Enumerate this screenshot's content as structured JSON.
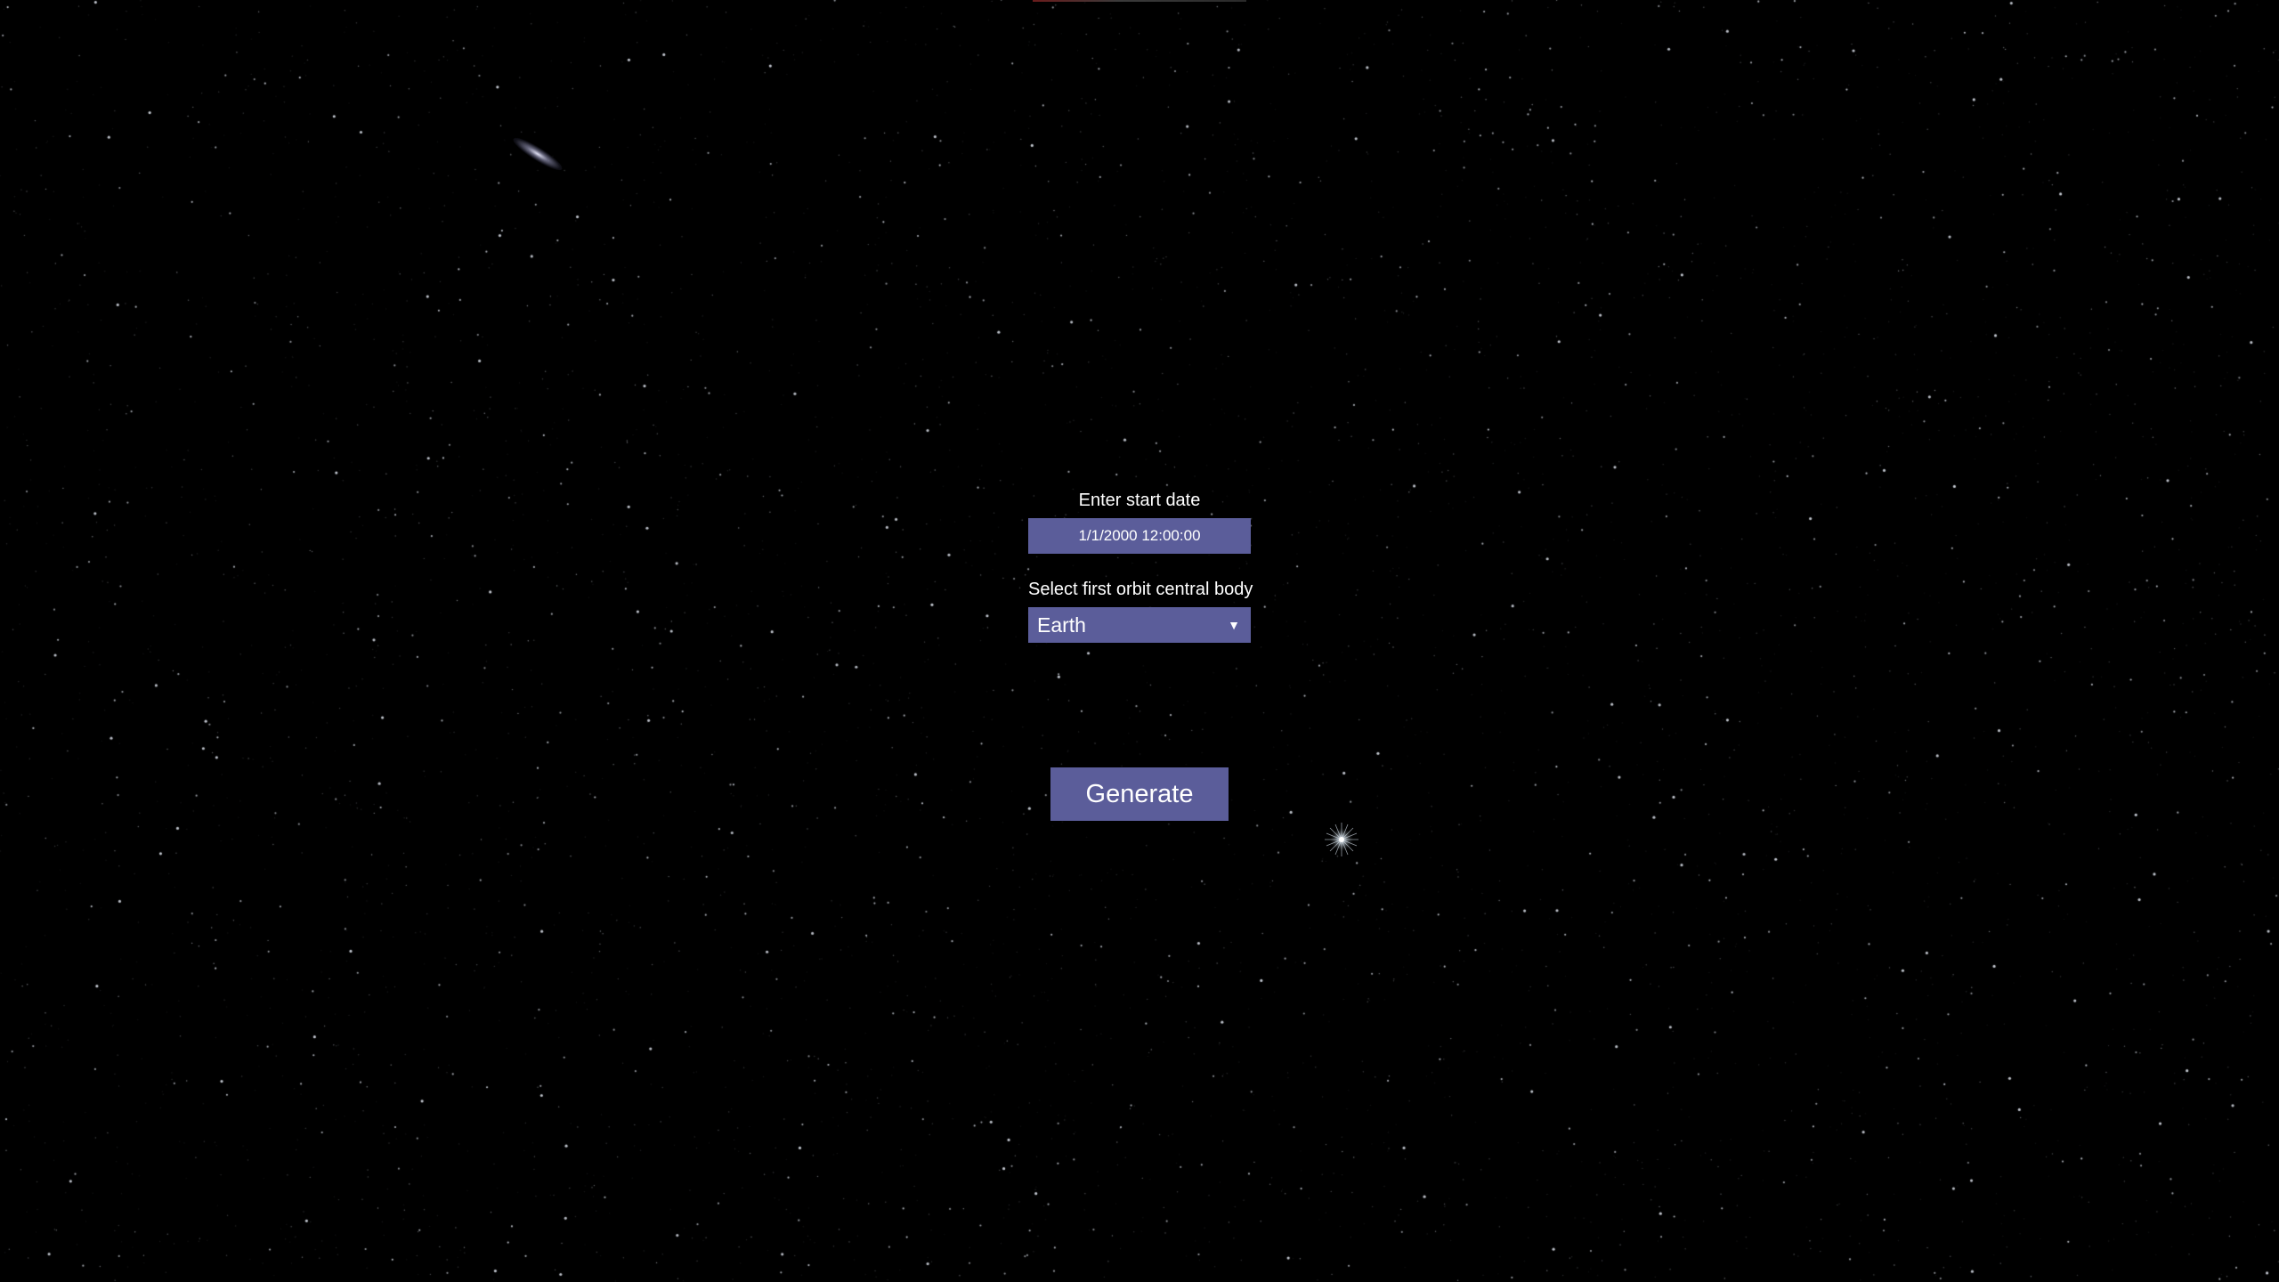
{
  "form": {
    "date_label": "Enter start date",
    "date_value": "1/1/2000 12:00:00",
    "central_body_label": "Select first orbit central body",
    "central_body_selected": "Earth",
    "dropdown_icon": "chevron-down-icon",
    "generate_label": "Generate"
  },
  "colors": {
    "background": "#000000",
    "control_fill": "#5b5d9a",
    "text": "#ffffff"
  }
}
